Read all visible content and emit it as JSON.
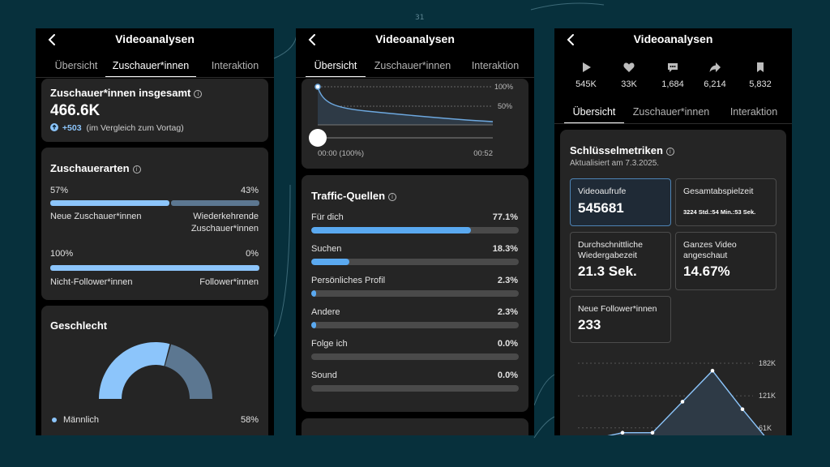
{
  "page_number": "31",
  "colors": {
    "background": "#07303c",
    "bar_blue": "#8cc5fb",
    "bar_slate": "#5c7791",
    "fill_blue": "#5aa9f0"
  },
  "screens": [
    {
      "title": "Videoanalysen",
      "tabs": [
        "Übersicht",
        "Zuschauer*innen",
        "Interaktion"
      ],
      "active_tab": "Zuschauer*innen",
      "total_viewers": {
        "title": "Zuschauer*innen insgesamt",
        "value": "466.6K",
        "change": "+503",
        "note": "(im Vergleich zum Vortag)"
      },
      "viewer_types": {
        "title": "Zuschauerarten",
        "row1": {
          "left_pct": "57%",
          "right_pct": "43%",
          "left_label": "Neue Zuschauer*innen",
          "right_label_1": "Wiederkehrende",
          "right_label_2": "Zuschauer*innen",
          "left_value": 57
        },
        "row2": {
          "left_pct": "100%",
          "right_pct": "0%",
          "left_label": "Nicht-Follower*innen",
          "right_label": "Follower*innen",
          "left_value": 100
        }
      },
      "gender": {
        "title": "Geschlecht",
        "male_label": "Männlich",
        "male_pct": "58%",
        "male_value": 58
      }
    },
    {
      "title": "Videoanalysen",
      "tabs": [
        "Übersicht",
        "Zuschauer*innen",
        "Interaktion"
      ],
      "active_tab": "Übersicht",
      "retention": {
        "label_100": "100%",
        "label_50": "50%",
        "time_start": "00:00 (100%)",
        "time_end": "00:52"
      },
      "traffic": {
        "title": "Traffic-Quellen",
        "sources": [
          {
            "label": "Für dich",
            "pct": "77.1%",
            "value": 77.1
          },
          {
            "label": "Suchen",
            "pct": "18.3%",
            "value": 18.3
          },
          {
            "label": "Persönliches Profil",
            "pct": "2.3%",
            "value": 2.3
          },
          {
            "label": "Andere",
            "pct": "2.3%",
            "value": 2.3
          },
          {
            "label": "Folge ich",
            "pct": "0.0%",
            "value": 0
          },
          {
            "label": "Sound",
            "pct": "0.0%",
            "value": 0
          }
        ]
      }
    },
    {
      "title": "Videoanalysen",
      "tabs": [
        "Übersicht",
        "Zuschauer*innen",
        "Interaktion"
      ],
      "active_tab": "Übersicht",
      "stats": [
        {
          "icon": "play-icon",
          "value": "545K"
        },
        {
          "icon": "heart-icon",
          "value": "33K"
        },
        {
          "icon": "comment-icon",
          "value": "1,684"
        },
        {
          "icon": "share-icon",
          "value": "6,214"
        },
        {
          "icon": "bookmark-icon",
          "value": "5,832"
        }
      ],
      "metrics": {
        "title": "Schlüsselmetriken",
        "updated": "Aktualisiert am 7.3.2025.",
        "video_views": {
          "label": "Videoaufrufe",
          "value": "545681"
        },
        "total_play_time": {
          "label": "Gesamtabspielzeit",
          "value": "3224 Std.:54 Min.:53 Sek."
        },
        "avg_watch_time": {
          "label_1": "Durchschnittliche",
          "label_2": "Wiedergabezeit",
          "value": "21.3 Sek."
        },
        "full_video": {
          "label_1": "Ganzes Video",
          "label_2": "angeschaut",
          "value": "14.67%"
        },
        "new_followers": {
          "label": "Neue Follower*innen",
          "value": "233"
        }
      },
      "chart_data": {
        "type": "line",
        "y_tick_labels": [
          "182K",
          "121K",
          "61K"
        ],
        "ylim": [
          0,
          182
        ],
        "grid": true,
        "values": [
          40,
          52,
          52,
          110,
          168,
          96,
          28
        ]
      }
    }
  ]
}
